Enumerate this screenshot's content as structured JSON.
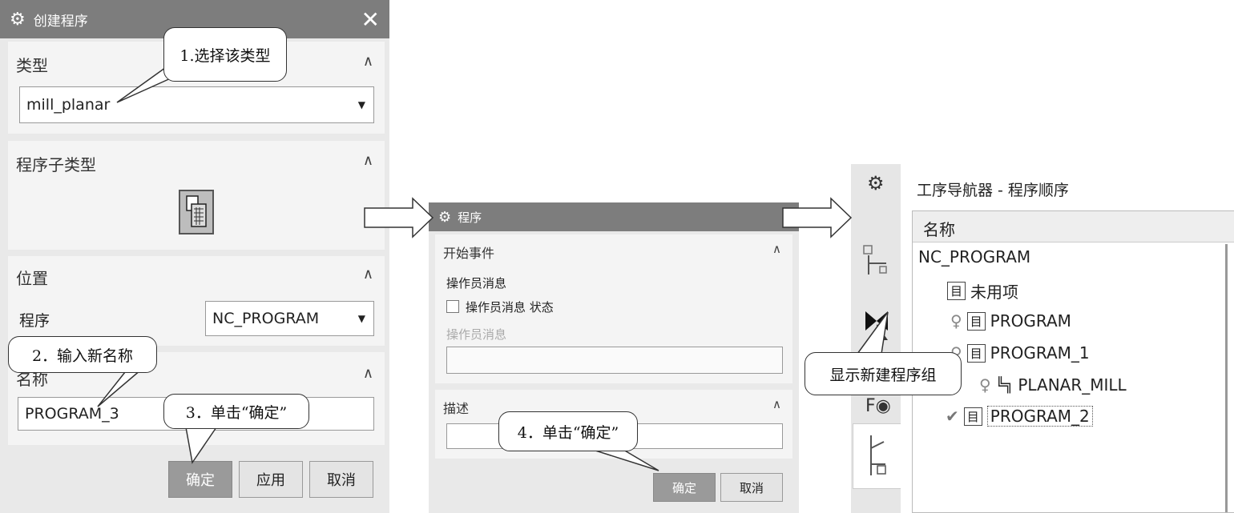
{
  "dialog_create": {
    "title": "创建程序",
    "close": "✕",
    "type_section": {
      "title": "类型",
      "value": "mill_planar"
    },
    "subtype_section": {
      "title": "程序子类型"
    },
    "location_section": {
      "title": "位置",
      "program_label": "程序",
      "program_value": "NC_PROGRAM"
    },
    "name_section": {
      "title": "名称",
      "value": "PROGRAM_3"
    },
    "buttons": {
      "ok": "确定",
      "apply": "应用",
      "cancel": "取消"
    }
  },
  "dialog_program": {
    "title": "程序",
    "start_event": {
      "title": "开始事件",
      "operator_message": "操作员消息",
      "status_checkbox": "操作员消息 状态",
      "message_label": "操作员消息"
    },
    "description": {
      "title": "描述"
    },
    "buttons": {
      "ok": "确定",
      "cancel": "取消"
    }
  },
  "navigator": {
    "title": "工序导航器 - 程序顺序",
    "column_header": "名称",
    "rows": [
      {
        "label": "NC_PROGRAM"
      },
      {
        "label": "未用项"
      },
      {
        "label": "PROGRAM"
      },
      {
        "label": "PROGRAM_1"
      },
      {
        "label": "PLANAR_MILL"
      },
      {
        "label": "PROGRAM_2"
      }
    ]
  },
  "callouts": {
    "step1": "1.选择该类型",
    "step2": "2．输入新名称",
    "step3": "3．单击“确定”",
    "step4": "4．单击“确定”",
    "result": "显示新建程序组"
  },
  "colors": {
    "titlebar": "#7d7d7d",
    "dialog_bg": "#e9e9e9",
    "section_bg": "#f4f4f4",
    "primary_button": "#9a9a9a"
  }
}
